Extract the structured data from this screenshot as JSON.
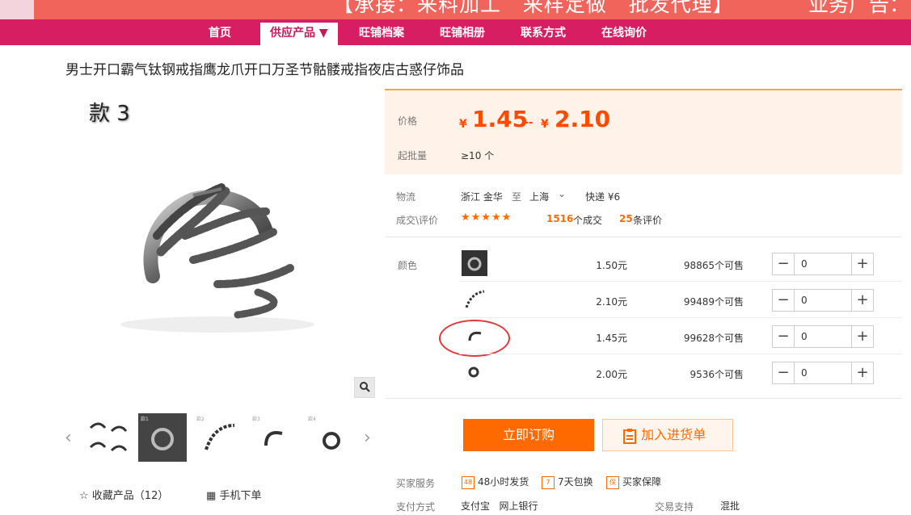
{
  "banner": {
    "text": "【承接：来料加工   来样定做   批发代理】",
    "text2": "业务广告："
  },
  "nav": {
    "items": [
      {
        "label": "首页"
      },
      {
        "label": "供应产品 ▼"
      },
      {
        "label": "旺铺档案"
      },
      {
        "label": "旺铺相册"
      },
      {
        "label": "联系方式"
      },
      {
        "label": "在线询价"
      }
    ]
  },
  "product": {
    "title": "男士开口霸气钛钢戒指鹰龙爪开口万圣节骷髅戒指夜店古惑仔饰品",
    "image_overlay": "款 3"
  },
  "gallery": {
    "thumb_labels": [
      "",
      "款1",
      "款2",
      "款3",
      "款4"
    ]
  },
  "actions": {
    "favorite_label": "收藏产品（12）",
    "mobile_label": "手机下单"
  },
  "pricing": {
    "price_label": "价格",
    "currency": "¥",
    "price_low": "1.45",
    "price_sep": "--",
    "price_high": "2.10",
    "moq_label": "起批量",
    "moq_value": "≥10 个"
  },
  "logistics": {
    "label": "物流",
    "from": "浙江 金华",
    "to_word": "至",
    "to": "上海",
    "shipping": "快递 ¥6"
  },
  "reviews": {
    "label": "成交\\评价",
    "stars": "★★★★★",
    "deals_count": "1516",
    "deals_suffix": "个成交",
    "review_count": "25",
    "review_suffix": "条评价"
  },
  "sku": {
    "label": "颜色",
    "rows": [
      {
        "price": "1.50元",
        "stock": "98865个可售",
        "qty": "0"
      },
      {
        "price": "2.10元",
        "stock": "99489个可售",
        "qty": "0"
      },
      {
        "price": "1.45元",
        "stock": "99628个可售",
        "qty": "0"
      },
      {
        "price": "2.00元",
        "stock": "9536个可售",
        "qty": "0"
      }
    ]
  },
  "buttons": {
    "order": "立即订购",
    "cart": "加入进货单"
  },
  "services": {
    "label": "买家服务",
    "items": [
      {
        "icon": "48",
        "text": "48小时发货"
      },
      {
        "icon": "7",
        "text": "7天包换"
      },
      {
        "icon": "保",
        "text": "买家保障"
      }
    ]
  },
  "payment": {
    "label": "支付方式",
    "methods": "支付宝   网上银行",
    "trade_label": "交易支持",
    "trade_value": "混批"
  },
  "colors": {
    "nav_bg": "#d81e62",
    "banner_bg": "#f0645c",
    "accent": "#ff6a00",
    "price": "#ff4a00"
  }
}
